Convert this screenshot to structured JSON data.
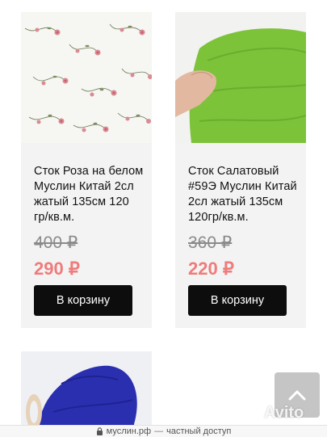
{
  "products": [
    {
      "title": "Сток Роза на белом Муслин Китай 2сл жатый 135см 120 гр/кв.м.",
      "old_price": "400 ₽",
      "new_price": "290 ₽",
      "button_label": "В корзину"
    },
    {
      "title": "Сток Салатовый #59Э Муслин Китай 2сл жатый 135см 120гр/кв.м.",
      "old_price": "360 ₽",
      "new_price": "220 ₽",
      "button_label": "В корзину"
    }
  ],
  "colors": {
    "card_bg": "#f3f3f3",
    "sale_price": "#f07b7b",
    "button_bg": "#0d0d0d",
    "green_fabric": "#7cc33a",
    "blue_fabric": "#2a2fb0"
  },
  "watermark": "Avito",
  "bottom_bar": {
    "domain": "муслин.рф",
    "separator": "—",
    "status": "частный доступ"
  }
}
